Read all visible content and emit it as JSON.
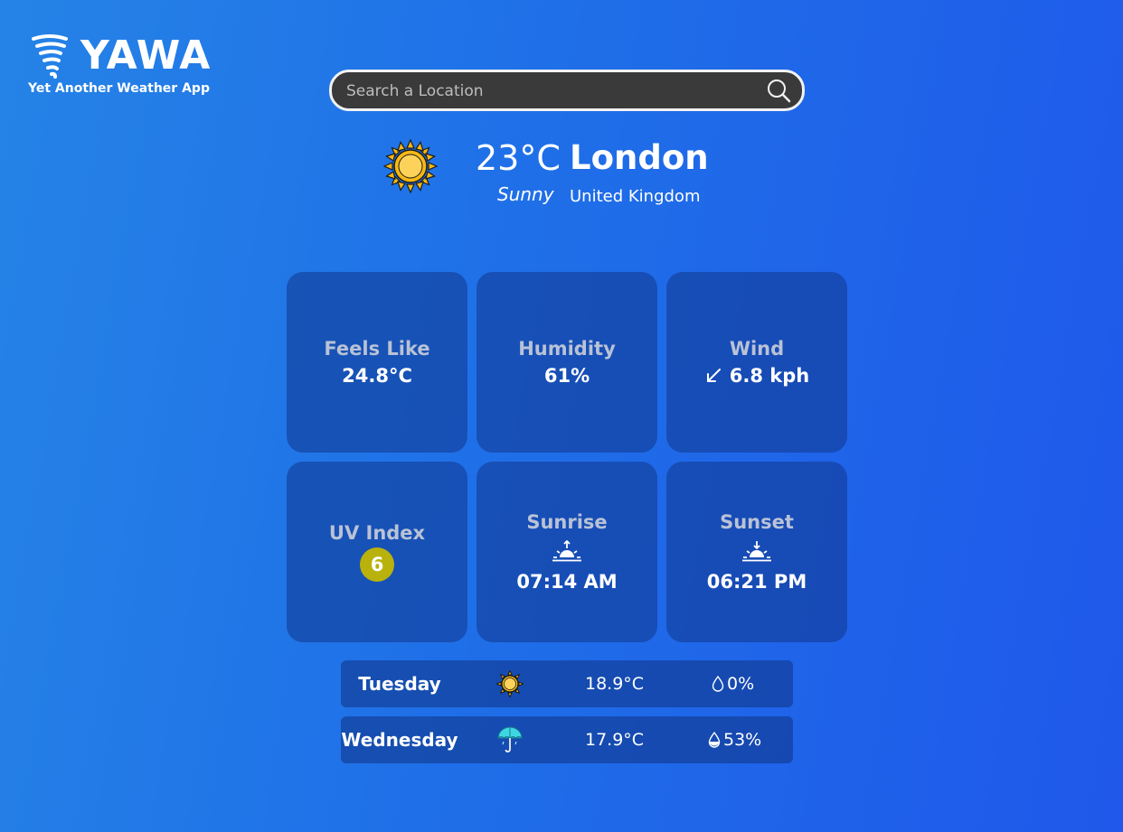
{
  "brand": {
    "name": "YAWA",
    "tagline": "Yet Another Weather App",
    "icon": "tornado-icon"
  },
  "search": {
    "placeholder": "Search a Location",
    "value": "",
    "icon": "search-icon"
  },
  "current": {
    "temperature": "23°C",
    "condition": "Sunny",
    "city": "London",
    "country": "United Kingdom",
    "icon": "sun-icon"
  },
  "tiles": {
    "feels_like": {
      "label": "Feels Like",
      "value": "24.8°C"
    },
    "humidity": {
      "label": "Humidity",
      "value": "61%"
    },
    "wind": {
      "label": "Wind",
      "value": "6.8 kph",
      "icon": "arrow-down-left-icon"
    },
    "uv": {
      "label": "UV Index",
      "value": "6",
      "color": "#b9b10c"
    },
    "sunrise": {
      "label": "Sunrise",
      "value": "07:14 AM",
      "icon": "sunrise-icon"
    },
    "sunset": {
      "label": "Sunset",
      "value": "06:21 PM",
      "icon": "sunset-icon"
    }
  },
  "forecast": [
    {
      "day": "Tuesday",
      "icon": "sun-icon",
      "temp": "18.9°C",
      "rain": "0%",
      "rain_icon": "drop-outline-icon"
    },
    {
      "day": "Wednesday",
      "icon": "umbrella-icon",
      "temp": "17.9°C",
      "rain": "53%",
      "rain_icon": "drop-half-icon"
    }
  ],
  "colors": {
    "background_start": "#2583e6",
    "background_end": "#1f58ea",
    "tile": "#173d8e",
    "search_bg": "#3a3a3a"
  }
}
